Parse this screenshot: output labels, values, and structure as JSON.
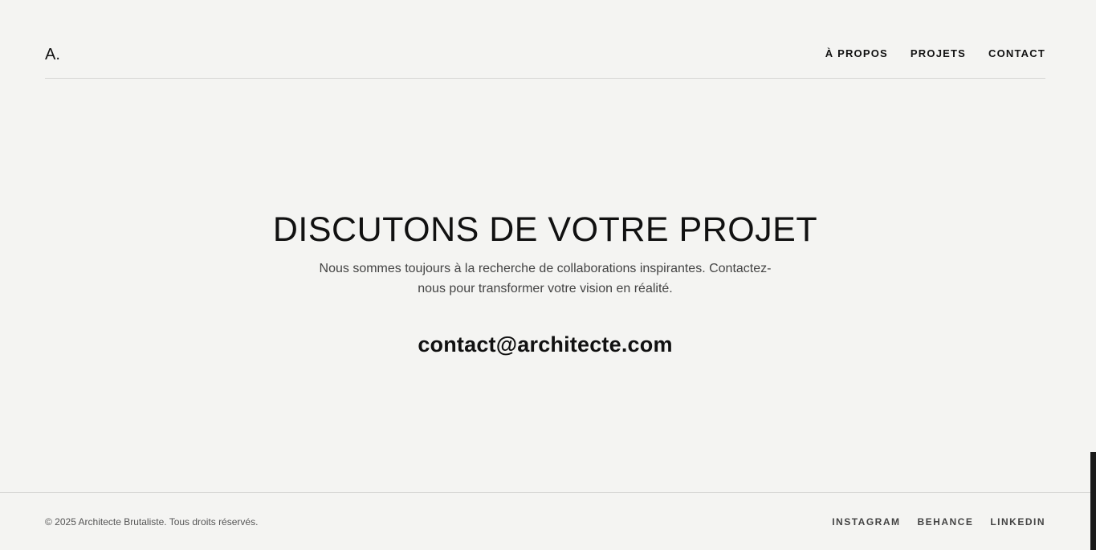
{
  "header": {
    "logo": "A.",
    "nav": [
      {
        "label": "À PROPOS"
      },
      {
        "label": "PROJETS"
      },
      {
        "label": "CONTACT"
      }
    ]
  },
  "hero": {
    "title": "DISCUTONS DE VOTRE PROJET",
    "text": "Nous sommes toujours à la recherche de collaborations inspirantes. Contactez-nous pour transformer votre vision en réalité.",
    "email": "contact@architecte.com"
  },
  "footer": {
    "copyright": "© 2025 Architecte Brutaliste. Tous droits réservés.",
    "social": [
      {
        "label": "INSTAGRAM"
      },
      {
        "label": "BEHANCE"
      },
      {
        "label": "LINKEDIN"
      }
    ]
  }
}
